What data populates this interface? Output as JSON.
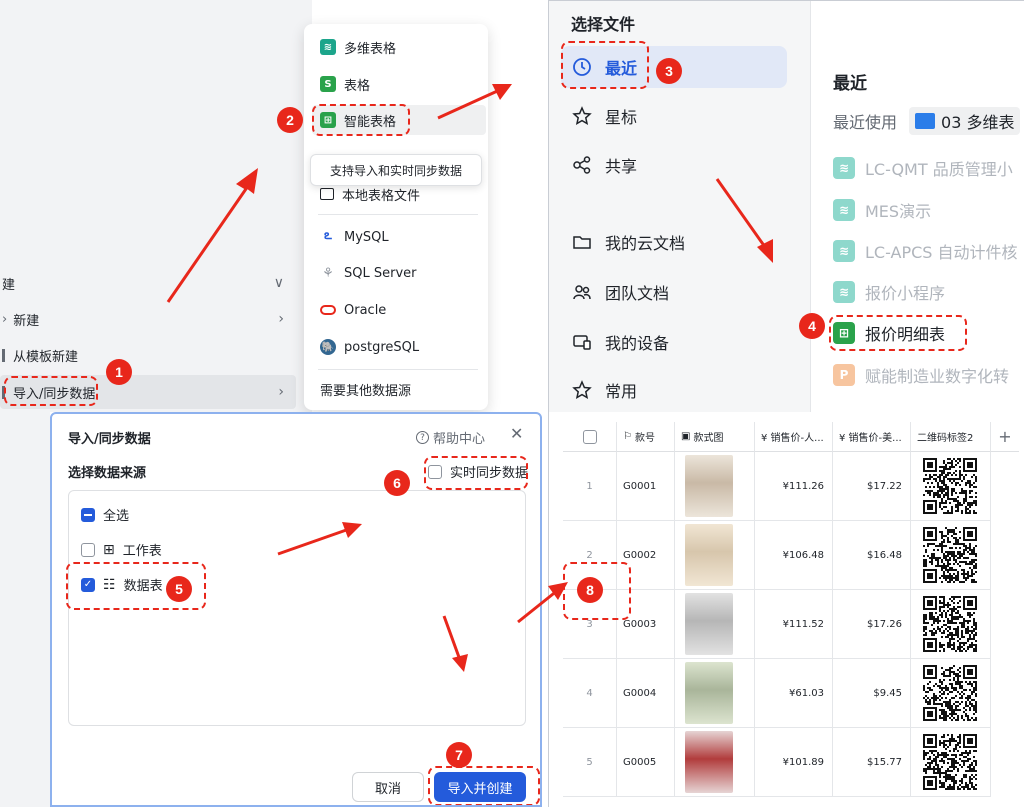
{
  "panel1": {
    "left_items": [
      {
        "label": "建",
        "chev": "∨"
      },
      {
        "label": "新建",
        "chev": "›"
      },
      {
        "label": "从模板新建",
        "chev": ""
      },
      {
        "label": "导入/同步数据",
        "chev": "›"
      }
    ],
    "menu": [
      {
        "label": "多维表格",
        "icon": "bitable-icon",
        "color": "#1ca58b"
      },
      {
        "label": "表格",
        "icon": "sheet-icon",
        "color": "#2aa24b"
      },
      {
        "label": "智能表格",
        "icon": "smart-sheet-icon",
        "color": "#2aa24b"
      },
      {
        "label": "本地表格文件",
        "icon": "monitor-icon"
      },
      {
        "label": "MySQL",
        "icon": "mysql-icon"
      },
      {
        "label": "SQL Server",
        "icon": "sqlserver-icon"
      },
      {
        "label": "Oracle",
        "icon": "oracle-icon"
      },
      {
        "label": "postgreSQL",
        "icon": "postgresql-icon"
      },
      {
        "label": "需要其他数据源"
      }
    ],
    "tooltip": "支持导入和实时同步数据"
  },
  "panel2": {
    "title": "选择文件",
    "nav": [
      {
        "label": "最近",
        "icon": "clock-icon"
      },
      {
        "label": "星标",
        "icon": "star-icon"
      },
      {
        "label": "共享",
        "icon": "share-icon"
      },
      {
        "label": "我的云文档",
        "icon": "folder-icon"
      },
      {
        "label": "团队文档",
        "icon": "team-icon"
      },
      {
        "label": "我的设备",
        "icon": "device-icon"
      },
      {
        "label": "常用",
        "icon": "pin-icon"
      }
    ],
    "section": "最近",
    "recent_label": "最近使用",
    "recent_folder": "03 多维表",
    "files": [
      {
        "label": "LC-QMT 品质管理小",
        "dim": true
      },
      {
        "label": "MES演示",
        "dim": true
      },
      {
        "label": "LC-APCS 自动计件核",
        "dim": true
      },
      {
        "label": "报价小程序",
        "dim": true
      },
      {
        "label": "报价明细表",
        "dim": false
      },
      {
        "label": "赋能制造业数字化转",
        "dim": true
      }
    ]
  },
  "panel3": {
    "title": "导入/同步数据",
    "help": "帮助中心",
    "close": "✕",
    "subtitle": "选择数据来源",
    "realtime": "实时同步数据",
    "select_all": "全选",
    "worksheet": "工作表",
    "datasheet": "数据表",
    "cancel": "取消",
    "confirm": "导入并创建"
  },
  "panel4": {
    "headers": [
      "款号",
      "款式图",
      "¥ 销售价-人...",
      "¥ 销售价-美...",
      "二维码标签2"
    ],
    "add": "+",
    "rows": [
      {
        "no": "1",
        "code": "G0001",
        "cny": "¥111.26",
        "usd": "$17.22"
      },
      {
        "no": "2",
        "code": "G0002",
        "cny": "¥106.48",
        "usd": "$16.48"
      },
      {
        "no": "3",
        "code": "G0003",
        "cny": "¥111.52",
        "usd": "$17.26"
      },
      {
        "no": "4",
        "code": "G0004",
        "cny": "¥61.03",
        "usd": "$9.45"
      },
      {
        "no": "5",
        "code": "G0005",
        "cny": "¥101.89",
        "usd": "$15.77"
      }
    ]
  },
  "badges": [
    "1",
    "2",
    "3",
    "4",
    "5",
    "6",
    "7",
    "8"
  ],
  "colors": {
    "accent": "#e8271b",
    "primary": "#245bdb"
  }
}
